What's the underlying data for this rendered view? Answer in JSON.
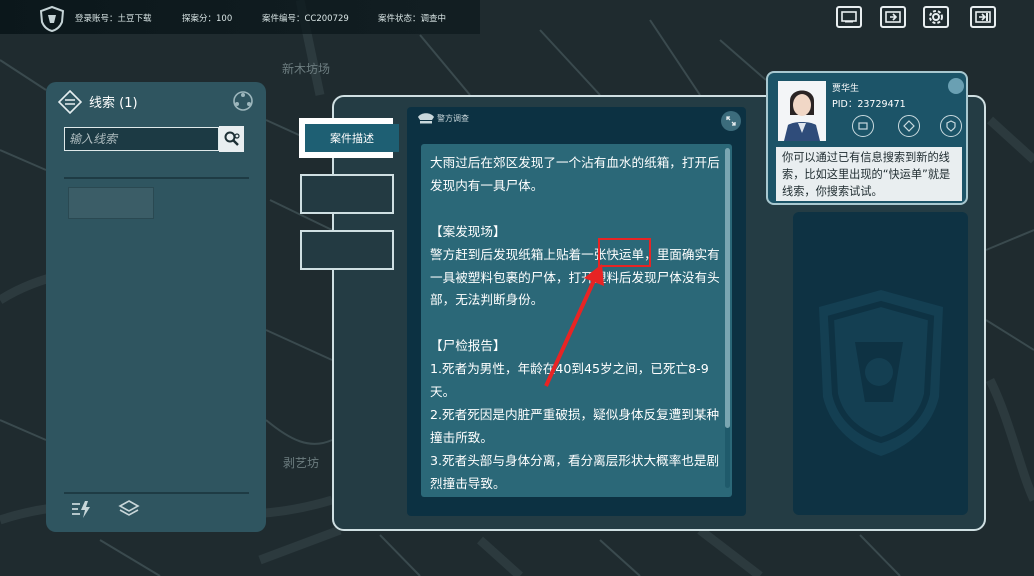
{
  "map": {
    "labels": [
      "新木坊场",
      "剥艺坊"
    ]
  },
  "topbar": {
    "account": "登录账号：土豆下载",
    "score": "探案分：100",
    "case_id": "案件编号：CC200729",
    "case_status": "案件状态：调查中"
  },
  "top_icons": [
    "screen-icon",
    "export-icon",
    "settings-icon",
    "exit-icon"
  ],
  "clue_panel": {
    "title": "线索 (1)",
    "search_placeholder": "输入线索"
  },
  "tabs": [
    {
      "label": "案件描述",
      "active": true
    },
    {
      "label": "",
      "active": false
    },
    {
      "label": "",
      "active": false
    }
  ],
  "description": {
    "header": "警方调查",
    "text": "大雨过后在郊区发现了一个沾有血水的纸箱，打开后发现内有一具尸体。\n\n【案发现场】\n警方赶到后发现纸箱上贴着一张快运单，里面确实有一具被塑料包裹的尸体，打开塑料后发现尸体没有头部，无法判断身份。\n\n【尸检报告】\n1.死者为男性，年龄在40到45岁之间，已死亡8-9天。\n2.死者死因是内脏严重破损，疑似身体反复遭到某种撞击所致。\n3.死者头部与身体分离，看分离层形状大概率也是剧烈撞击导致。"
  },
  "character": {
    "name": "贾华生",
    "pid": "PID：23729471",
    "speech": "你可以通过已有信息搜索到新的线索，比如这里出现的“快运单”就是线索，你搜索试试。"
  },
  "colors": {
    "highlight": "#e82424",
    "panel": "#2f5560",
    "card": "#0c3142",
    "text_bg": "#2b6878"
  }
}
